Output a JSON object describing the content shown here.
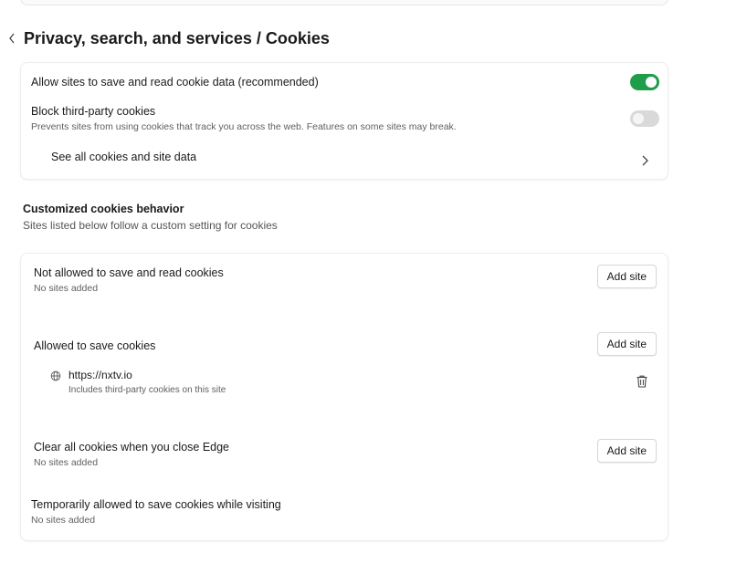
{
  "header": {
    "title": "Privacy, search, and services / Cookies"
  },
  "cookies": {
    "allow_label": "Allow sites to save and read cookie data (recommended)",
    "allow_on": true,
    "block_label": "Block third-party cookies",
    "block_desc": "Prevents sites from using cookies that track you across the web. Features on some sites may break.",
    "block_on": false,
    "see_all_label": "See all cookies and site data"
  },
  "custom": {
    "title": "Customized cookies behavior",
    "subtitle": "Sites listed below follow a custom setting for cookies",
    "not_allowed": {
      "label": "Not allowed to save and read cookies",
      "status": "No sites added",
      "button": "Add site"
    },
    "allowed": {
      "label": "Allowed to save cookies",
      "button": "Add site",
      "sites": [
        {
          "url": "https://nxtv.io",
          "note": "Includes third-party cookies on this site"
        }
      ]
    },
    "clear_on_close": {
      "label": "Clear all cookies when you close Edge",
      "status": "No sites added",
      "button": "Add site"
    },
    "temporary": {
      "label": "Temporarily allowed to save cookies while visiting",
      "status": "No sites added"
    }
  },
  "colors": {
    "toggle_on": "#1f9d4a",
    "toggle_off": "#d9d9d9"
  }
}
